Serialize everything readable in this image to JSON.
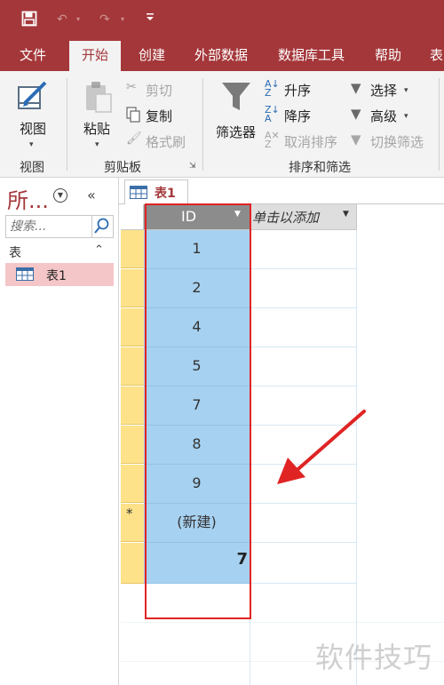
{
  "tabs": [
    "文件",
    "开始",
    "创建",
    "外部数据",
    "数据库工具",
    "帮助",
    "表"
  ],
  "ribbon": {
    "view": {
      "label": "视图",
      "group": "视图"
    },
    "clipboard": {
      "paste": "粘贴",
      "cut": "剪切",
      "copy": "复制",
      "format_painter": "格式刷",
      "group": "剪贴板"
    },
    "sort_filter": {
      "filter": "筛选器",
      "ascending": "升序",
      "descending": "降序",
      "remove_sort": "取消排序",
      "selection": "选择",
      "advanced": "高级",
      "toggle_filter": "切换筛选",
      "group": "排序和筛选"
    }
  },
  "nav": {
    "title": "所...",
    "search_placeholder": "搜索...",
    "group": "表",
    "items": [
      "表1"
    ]
  },
  "doc_tab": "表1",
  "grid": {
    "headers": [
      "ID",
      "单击以添加"
    ],
    "rows": [
      "1",
      "2",
      "4",
      "5",
      "7",
      "8",
      "9"
    ],
    "new_row": "(新建)",
    "new_marker": "*",
    "total": "7"
  },
  "watermark": "软件技巧",
  "colors": {
    "brand": "#a4373a",
    "ribbon_bg": "#f3f3f3",
    "selection": "#a7d1f0",
    "row_selector": "#fde28a",
    "highlight_border": "#e02424",
    "arrow": "#e02424"
  }
}
